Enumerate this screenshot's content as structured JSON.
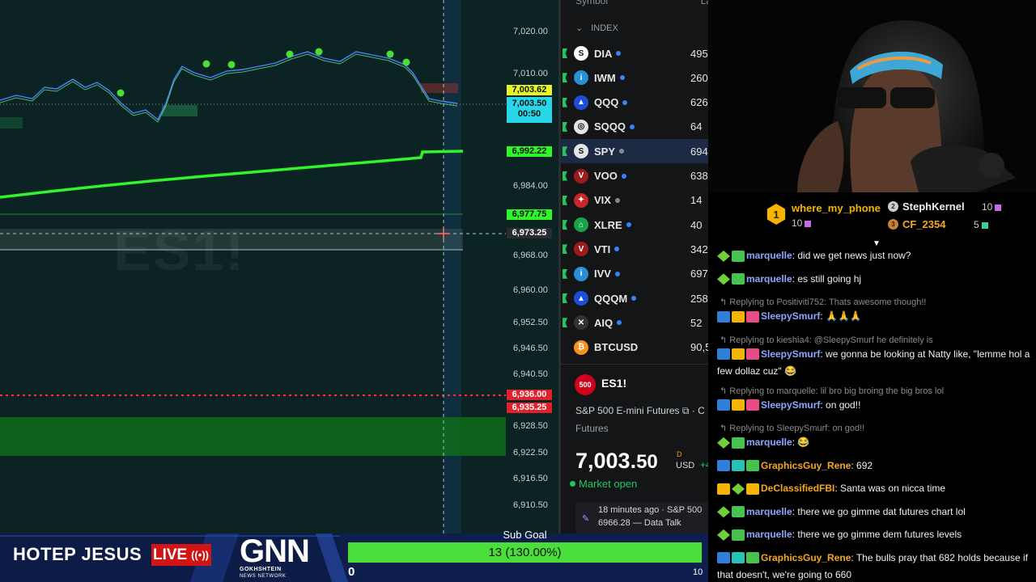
{
  "colors": {
    "chart_bg": "#0b2423",
    "accent_green": "#4ade3a",
    "live_red": "#d21414",
    "bar_blue": "#0f1f4d"
  },
  "chart": {
    "symbol_watermark": "ES1!",
    "price_axis": [
      "7,020.00",
      "7,010.00",
      "6,984.00",
      "6,968.00",
      "6,960.00",
      "6,952.50",
      "6,946.50",
      "6,940.50",
      "6,928.50",
      "6,922.50",
      "6,916.50",
      "6,910.50"
    ],
    "tags": {
      "last_top": "7,003.62",
      "last_mid": "7,003.50",
      "countdown": "00:50",
      "ma": "6,992.22",
      "level1": "6,977.75",
      "crosshair": "6,973.25",
      "red1": "6,936.00",
      "red2": "6,935.25"
    }
  },
  "watchlist": {
    "col_symbol": "Symbol",
    "col_last": "La",
    "section": "INDEX",
    "rows": [
      {
        "symbol": "DIA",
        "value": "495",
        "icon": "S"
      },
      {
        "symbol": "IWM",
        "value": "260",
        "icon": "i"
      },
      {
        "symbol": "QQQ",
        "value": "626",
        "icon": "▲"
      },
      {
        "symbol": "SQQQ",
        "value": "64",
        "icon": "◎"
      },
      {
        "symbol": "SPY",
        "value": "694",
        "icon": "S"
      },
      {
        "symbol": "VOO",
        "value": "638",
        "icon": "V"
      },
      {
        "symbol": "VIX",
        "value": "14",
        "icon": "✦"
      },
      {
        "symbol": "XLRE",
        "value": "40",
        "icon": "⌂"
      },
      {
        "symbol": "VTI",
        "value": "342",
        "icon": "V"
      },
      {
        "symbol": "IVV",
        "value": "697",
        "icon": "i"
      },
      {
        "symbol": "QQQM",
        "value": "258",
        "icon": "▲"
      },
      {
        "symbol": "AIQ",
        "value": "52",
        "icon": "✕"
      },
      {
        "symbol": "BTCUSD",
        "value": "90,5",
        "icon": "₿"
      }
    ],
    "detail": {
      "badge": "500",
      "symbol": "ES1!",
      "name": "S&P 500 E-mini Futures",
      "name_suffix": "C",
      "sub": "Futures",
      "price_int": "7,003.",
      "price_dec": "50",
      "d": "D",
      "currency": "USD",
      "change": "+4",
      "market": "Market open",
      "news_line1": "18 minutes ago · S&P 500",
      "news_line2": "6966.28 — Data Talk"
    }
  },
  "gifters": {
    "first": {
      "rank": "1",
      "name": "where_my_phone",
      "count": "10"
    },
    "second": {
      "rank": "2",
      "name": "StephKernel",
      "count": "10"
    },
    "third": {
      "rank": "3",
      "name": "CF_2354",
      "count": "5"
    }
  },
  "chat": [
    {
      "type": "msg",
      "user": "marquelle",
      "color": "#8aa8ff",
      "badges": [
        "b-green",
        "b-tv"
      ],
      "text": "did we get news just now?"
    },
    {
      "type": "msg",
      "user": "marquelle",
      "color": "#8aa8ff",
      "badges": [
        "b-green",
        "b-tv"
      ],
      "text": "es still going hj"
    },
    {
      "type": "reply",
      "text": "Replying to Positiviti752: Thats awesome though!!"
    },
    {
      "type": "msg",
      "user": "SleepySmurf",
      "color": "#8aa8ff",
      "badges": [
        "b-blue",
        "b-crown",
        "b-gift"
      ],
      "text": "🙏🙏🙏"
    },
    {
      "type": "reply",
      "text": "Replying to kieshia4: @SleepySmurf he definitely is"
    },
    {
      "type": "msg2",
      "user": "SleepySmurf",
      "color": "#8aa8ff",
      "badges": [
        "b-blue",
        "b-crown",
        "b-gift"
      ],
      "text": "we gonna be looking at Natty like, \"lemme hol a few dollaz cuz\" 😂"
    },
    {
      "type": "reply",
      "text": "Replying to marquelle: lil bro big broing the big bros lol"
    },
    {
      "type": "msg",
      "user": "SleepySmurf",
      "color": "#8aa8ff",
      "badges": [
        "b-blue",
        "b-crown",
        "b-gift"
      ],
      "text": "on god!!"
    },
    {
      "type": "reply",
      "text": "Replying to SleepySmurf: on god!!"
    },
    {
      "type": "msg",
      "user": "marquelle",
      "color": "#8aa8ff",
      "badges": [
        "b-green",
        "b-tv"
      ],
      "text": "😂"
    },
    {
      "type": "msg",
      "user": "GraphicsGuy_Rene",
      "color": "#f5a623",
      "badges": [
        "b-blue",
        "b-teal",
        "b-tv"
      ],
      "text": "692"
    },
    {
      "type": "msg",
      "user": "DeClassifiedFBI",
      "color": "#f5a623",
      "badges": [
        "b-crown",
        "b-green",
        "b-gold"
      ],
      "text": "Santa was on nicca time"
    },
    {
      "type": "msg",
      "user": "marquelle",
      "color": "#8aa8ff",
      "badges": [
        "b-green",
        "b-tv"
      ],
      "text": "there we go gimme dat futures chart lol"
    },
    {
      "type": "msg",
      "user": "marquelle",
      "color": "#8aa8ff",
      "badges": [
        "b-green",
        "b-tv"
      ],
      "text": "there we go gimme dem futures levels"
    },
    {
      "type": "msg2",
      "user": "GraphicsGuy_Rene",
      "color": "#f5a623",
      "badges": [
        "b-blue",
        "b-teal",
        "b-tv"
      ],
      "text": "The bulls pray that 682 holds because if that doesn't, we're going to 660"
    }
  ],
  "bar": {
    "brand": "HOTEP JESUS",
    "live": "LIVE",
    "live_icon": "((•))",
    "gnn": "GNN",
    "gnn_sub1": "GOKHSHTEIN",
    "gnn_sub2": "NEWS NETWORK",
    "subgoal_title": "Sub Goal",
    "subgoal_text": "13 (130.00%)",
    "subgoal_progress": 1.0,
    "min": "0",
    "max": "10"
  }
}
